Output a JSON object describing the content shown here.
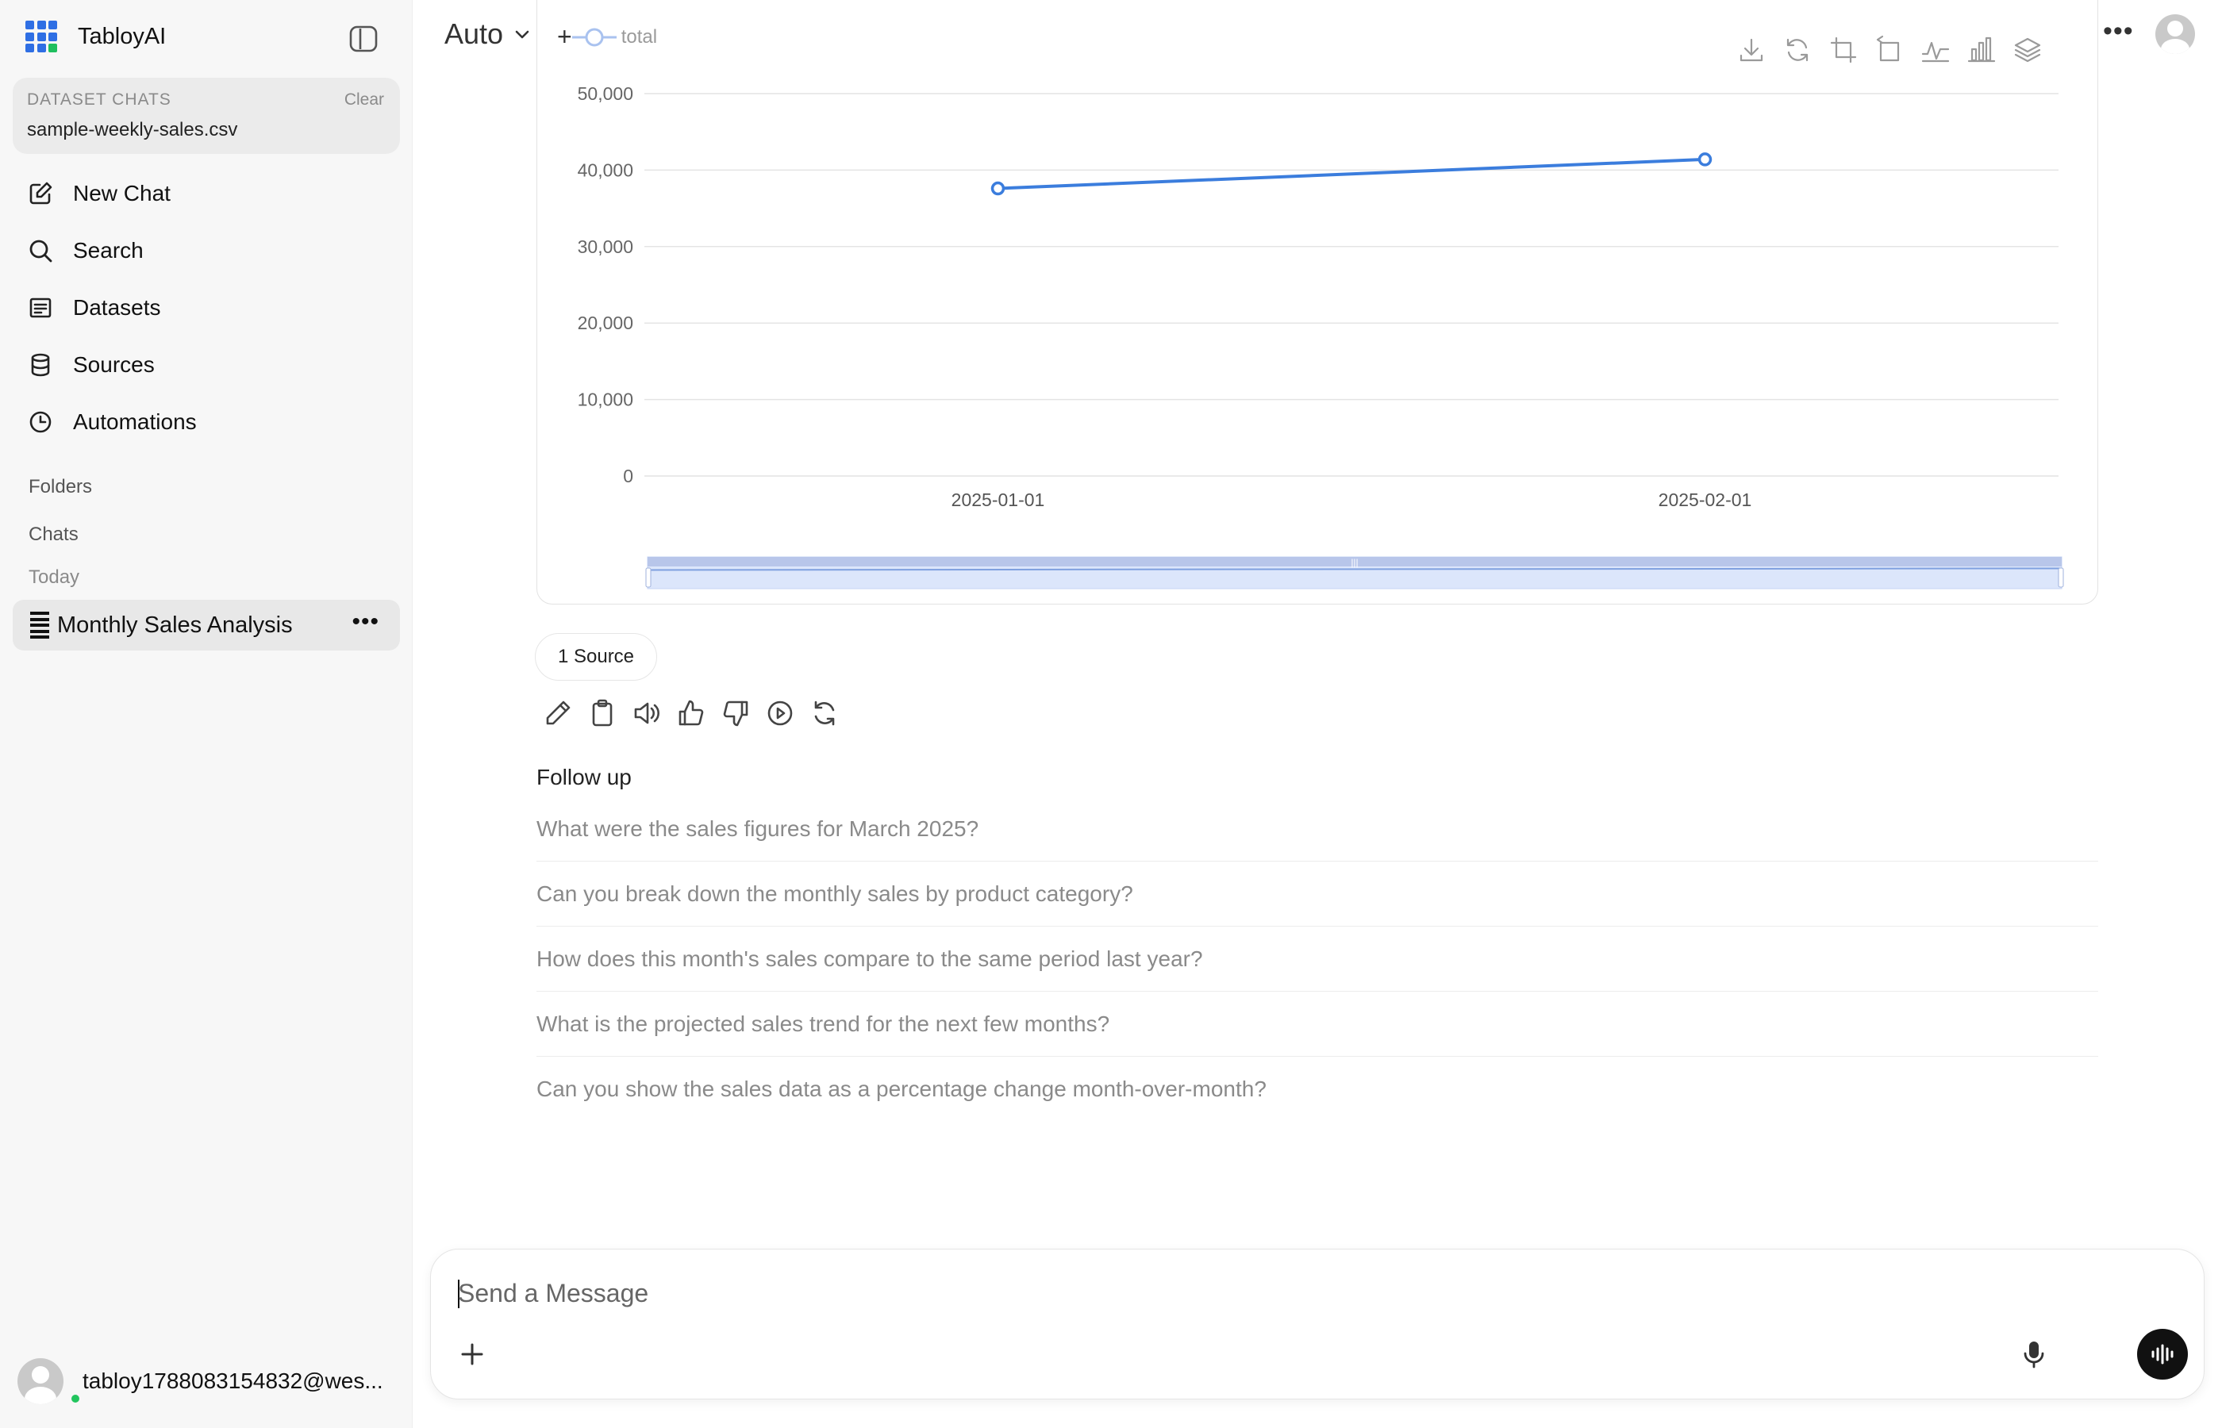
{
  "app": {
    "name": "TabloyAI",
    "brand_colors": {
      "blue": "#2f6fe4",
      "green": "#1fbf5f"
    }
  },
  "sidebar": {
    "toggle_icon": "sidebar-toggle-icon",
    "dataset": {
      "heading": "DATASET CHATS",
      "clear_label": "Clear",
      "file": "sample-weekly-sales.csv"
    },
    "nav": [
      {
        "label": "New Chat",
        "icon": "edit-icon"
      },
      {
        "label": "Search",
        "icon": "search-icon"
      },
      {
        "label": "Datasets",
        "icon": "list-icon"
      },
      {
        "label": "Sources",
        "icon": "database-icon"
      },
      {
        "label": "Automations",
        "icon": "clock-icon"
      }
    ],
    "folders_label": "Folders",
    "chats_label": "Chats",
    "today_label": "Today",
    "chats": [
      {
        "title": "Monthly Sales Analysis",
        "icon": "table-icon",
        "more": "•••"
      }
    ],
    "user": {
      "email": "tabloy1788083154832@wes...",
      "status_color": "#22c55e"
    }
  },
  "topbar": {
    "model": "Auto",
    "more": "•••"
  },
  "chart": {
    "legend_prefix": "+",
    "toolbox_icons": [
      "download-icon",
      "refresh-icon",
      "crop-icon",
      "undo-zoom-icon",
      "line-chart-icon",
      "bar-chart-icon",
      "stack-icon"
    ]
  },
  "chart_data": {
    "type": "line",
    "x": [
      "2025-01-01",
      "2025-02-01"
    ],
    "series": [
      {
        "name": "total",
        "values": [
          37600,
          41400
        ],
        "color": "#3b7ddd"
      }
    ],
    "yticks": [
      "50,000",
      "40,000",
      "30,000",
      "20,000",
      "10,000",
      "0"
    ],
    "ylim": [
      0,
      50000
    ],
    "grid": true,
    "legend": "top-left",
    "data_zoom": true
  },
  "message": {
    "source_label": "1 Source",
    "action_icons": [
      "edit-icon",
      "copy-icon",
      "speaker-icon",
      "thumbs-up-icon",
      "thumbs-down-icon",
      "play-icon",
      "regenerate-icon"
    ],
    "followup_title": "Follow up",
    "followups": [
      "What were the sales figures for March 2025?",
      "Can you break down the monthly sales by product category?",
      "How does this month's sales compare to the same period last year?",
      "What is the projected sales trend for the next few months?",
      "Can you show the sales data as a percentage change month-over-month?"
    ]
  },
  "composer": {
    "placeholder": "Send a Message",
    "value": ""
  }
}
